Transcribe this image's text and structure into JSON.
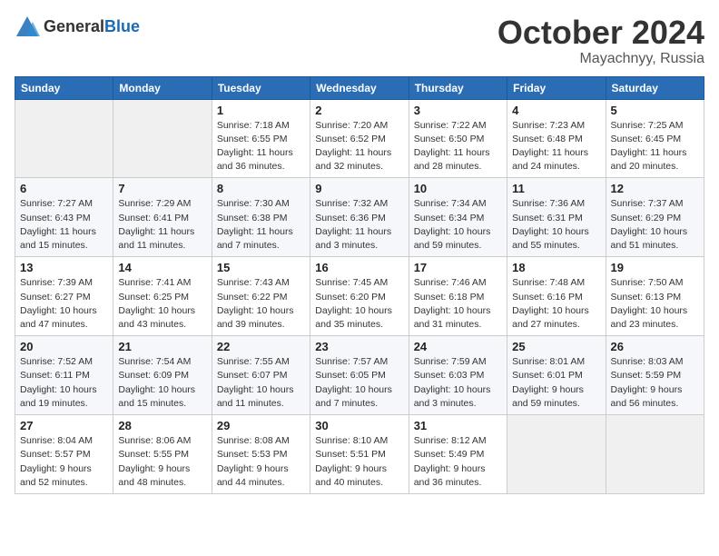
{
  "logo": {
    "general": "General",
    "blue": "Blue"
  },
  "title": {
    "month": "October 2024",
    "location": "Mayachnyy, Russia"
  },
  "weekdays": [
    "Sunday",
    "Monday",
    "Tuesday",
    "Wednesday",
    "Thursday",
    "Friday",
    "Saturday"
  ],
  "weeks": [
    [
      {
        "day": "",
        "info": ""
      },
      {
        "day": "",
        "info": ""
      },
      {
        "day": "1",
        "sunrise": "7:18 AM",
        "sunset": "6:55 PM",
        "daylight": "11 hours and 36 minutes."
      },
      {
        "day": "2",
        "sunrise": "7:20 AM",
        "sunset": "6:52 PM",
        "daylight": "11 hours and 32 minutes."
      },
      {
        "day": "3",
        "sunrise": "7:22 AM",
        "sunset": "6:50 PM",
        "daylight": "11 hours and 28 minutes."
      },
      {
        "day": "4",
        "sunrise": "7:23 AM",
        "sunset": "6:48 PM",
        "daylight": "11 hours and 24 minutes."
      },
      {
        "day": "5",
        "sunrise": "7:25 AM",
        "sunset": "6:45 PM",
        "daylight": "11 hours and 20 minutes."
      }
    ],
    [
      {
        "day": "6",
        "sunrise": "7:27 AM",
        "sunset": "6:43 PM",
        "daylight": "11 hours and 15 minutes."
      },
      {
        "day": "7",
        "sunrise": "7:29 AM",
        "sunset": "6:41 PM",
        "daylight": "11 hours and 11 minutes."
      },
      {
        "day": "8",
        "sunrise": "7:30 AM",
        "sunset": "6:38 PM",
        "daylight": "11 hours and 7 minutes."
      },
      {
        "day": "9",
        "sunrise": "7:32 AM",
        "sunset": "6:36 PM",
        "daylight": "11 hours and 3 minutes."
      },
      {
        "day": "10",
        "sunrise": "7:34 AM",
        "sunset": "6:34 PM",
        "daylight": "10 hours and 59 minutes."
      },
      {
        "day": "11",
        "sunrise": "7:36 AM",
        "sunset": "6:31 PM",
        "daylight": "10 hours and 55 minutes."
      },
      {
        "day": "12",
        "sunrise": "7:37 AM",
        "sunset": "6:29 PM",
        "daylight": "10 hours and 51 minutes."
      }
    ],
    [
      {
        "day": "13",
        "sunrise": "7:39 AM",
        "sunset": "6:27 PM",
        "daylight": "10 hours and 47 minutes."
      },
      {
        "day": "14",
        "sunrise": "7:41 AM",
        "sunset": "6:25 PM",
        "daylight": "10 hours and 43 minutes."
      },
      {
        "day": "15",
        "sunrise": "7:43 AM",
        "sunset": "6:22 PM",
        "daylight": "10 hours and 39 minutes."
      },
      {
        "day": "16",
        "sunrise": "7:45 AM",
        "sunset": "6:20 PM",
        "daylight": "10 hours and 35 minutes."
      },
      {
        "day": "17",
        "sunrise": "7:46 AM",
        "sunset": "6:18 PM",
        "daylight": "10 hours and 31 minutes."
      },
      {
        "day": "18",
        "sunrise": "7:48 AM",
        "sunset": "6:16 PM",
        "daylight": "10 hours and 27 minutes."
      },
      {
        "day": "19",
        "sunrise": "7:50 AM",
        "sunset": "6:13 PM",
        "daylight": "10 hours and 23 minutes."
      }
    ],
    [
      {
        "day": "20",
        "sunrise": "7:52 AM",
        "sunset": "6:11 PM",
        "daylight": "10 hours and 19 minutes."
      },
      {
        "day": "21",
        "sunrise": "7:54 AM",
        "sunset": "6:09 PM",
        "daylight": "10 hours and 15 minutes."
      },
      {
        "day": "22",
        "sunrise": "7:55 AM",
        "sunset": "6:07 PM",
        "daylight": "10 hours and 11 minutes."
      },
      {
        "day": "23",
        "sunrise": "7:57 AM",
        "sunset": "6:05 PM",
        "daylight": "10 hours and 7 minutes."
      },
      {
        "day": "24",
        "sunrise": "7:59 AM",
        "sunset": "6:03 PM",
        "daylight": "10 hours and 3 minutes."
      },
      {
        "day": "25",
        "sunrise": "8:01 AM",
        "sunset": "6:01 PM",
        "daylight": "9 hours and 59 minutes."
      },
      {
        "day": "26",
        "sunrise": "8:03 AM",
        "sunset": "5:59 PM",
        "daylight": "9 hours and 56 minutes."
      }
    ],
    [
      {
        "day": "27",
        "sunrise": "8:04 AM",
        "sunset": "5:57 PM",
        "daylight": "9 hours and 52 minutes."
      },
      {
        "day": "28",
        "sunrise": "8:06 AM",
        "sunset": "5:55 PM",
        "daylight": "9 hours and 48 minutes."
      },
      {
        "day": "29",
        "sunrise": "8:08 AM",
        "sunset": "5:53 PM",
        "daylight": "9 hours and 44 minutes."
      },
      {
        "day": "30",
        "sunrise": "8:10 AM",
        "sunset": "5:51 PM",
        "daylight": "9 hours and 40 minutes."
      },
      {
        "day": "31",
        "sunrise": "8:12 AM",
        "sunset": "5:49 PM",
        "daylight": "9 hours and 36 minutes."
      },
      {
        "day": "",
        "info": ""
      },
      {
        "day": "",
        "info": ""
      }
    ]
  ]
}
